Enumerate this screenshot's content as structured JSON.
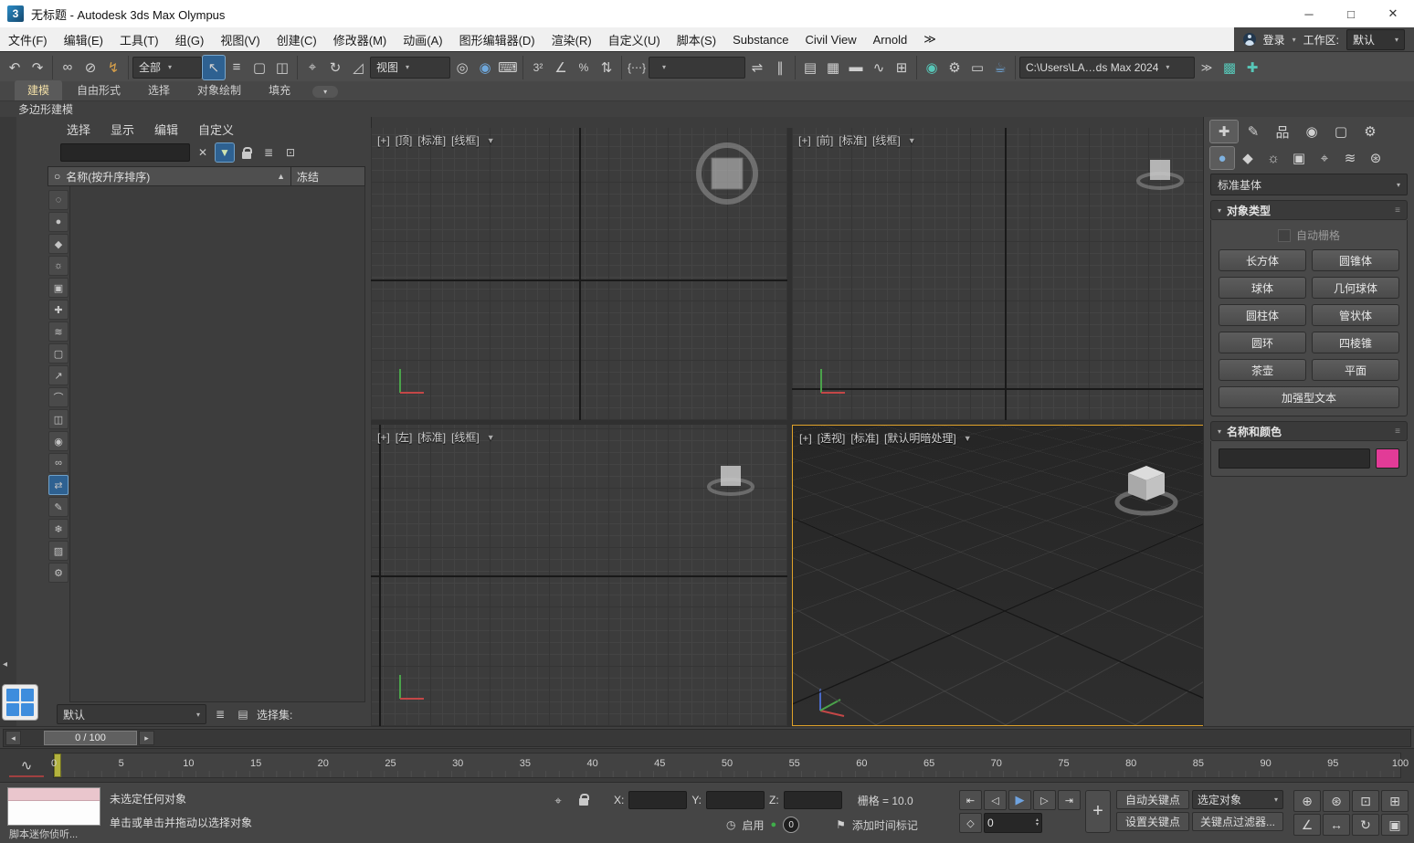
{
  "colors": {
    "active_viewport_border": "#e0a22a",
    "selection_highlight": "#2e6191",
    "name_color_swatch": "#e23b97",
    "play_button": "#6fa3e0",
    "enable_green": "#3fae4a",
    "explorer_layout_blue": "#3e8ddd"
  },
  "ui": {
    "caret": "▾",
    "sort_asc": "▲",
    "grip": "≡",
    "spin_up": "▴",
    "spin_down": "▾"
  },
  "window": {
    "app_badge": "3",
    "title": "无标题 - Autodesk 3ds Max Olympus",
    "min": "─",
    "max": "□",
    "close": "✕"
  },
  "menubar": {
    "items": [
      "文件(F)",
      "编辑(E)",
      "工具(T)",
      "组(G)",
      "视图(V)",
      "创建(C)",
      "修改器(M)",
      "动画(A)",
      "图形编辑器(D)",
      "渲染(R)",
      "自定义(U)",
      "脚本(S)",
      "Substance",
      "Civil View",
      "Arnold"
    ],
    "overflow": "≫",
    "signin": "登录",
    "workspace_label": "工作区:",
    "workspace_value": "默认"
  },
  "toolbar": {
    "filter_value": "全部",
    "coord_value": "视图",
    "path_value": "C:\\Users\\LA…ds Max 2024",
    "overflow": "≫",
    "icons": {
      "undo": "↶",
      "redo": "↷",
      "link": "∞",
      "unlink": "⊘",
      "bind": "↯",
      "select": "↖",
      "select_by_name": "≡",
      "region": "▢",
      "window_crossing": "◫",
      "move": "⌖",
      "rotate": "↻",
      "scale": "◿",
      "pivot": "◎",
      "manipulate": "◉",
      "keyboard": "⌨",
      "snap": "3²",
      "angle_snap": "∠",
      "percent_snap": "%",
      "spinner_snap": "⇅",
      "edit_named": "{⋯}",
      "mirror": "⇌",
      "align": "∥",
      "scene_explorer": "▤",
      "layer_explorer": "▦",
      "ribbon": "▬",
      "curve_editor": "∿",
      "schematic": "⊞",
      "material_editor": "◉",
      "render_setup": "⚙",
      "frame_window": "▭",
      "render": "☕",
      "extra1": "▩",
      "extra2": "✚"
    }
  },
  "ribbon": {
    "tabs": [
      "建模",
      "自由形式",
      "选择",
      "对象绘制",
      "填充"
    ],
    "subtab": "多边形建模"
  },
  "explorer": {
    "menus": [
      "选择",
      "显示",
      "编辑",
      "自定义"
    ],
    "clear": "✕",
    "funnel": "▼",
    "icon_columns": "≣",
    "icon_pick": "⊡",
    "header_radio": "○",
    "columns": {
      "name": "名称(按升序排序)",
      "frozen": "冻结"
    },
    "strip": [
      "◌",
      "●",
      "◆",
      "☼",
      "▣",
      "✚",
      "≋",
      "▢",
      "↗",
      "⌒",
      "◫",
      "◉",
      "∞",
      "⇄",
      "✎",
      "❄",
      "▨",
      "⚙"
    ],
    "footer": {
      "preset": "默认",
      "icon1": "≣",
      "icon2": "▤",
      "selection_set": "选择集:"
    }
  },
  "viewports": {
    "top": {
      "plus": "[+]",
      "view": "[顶]",
      "type": "[标准]",
      "shade": "[线框]"
    },
    "front": {
      "plus": "[+]",
      "view": "[前]",
      "type": "[标准]",
      "shade": "[线框]"
    },
    "left": {
      "plus": "[+]",
      "view": "[左]",
      "type": "[标准]",
      "shade": "[线框]"
    },
    "persp": {
      "plus": "[+]",
      "view": "[透视]",
      "type": "[标准]",
      "shade": "[默认明暗处理]"
    }
  },
  "panel": {
    "tabs1": [
      "✚",
      "✎",
      "品",
      "◉",
      "▢",
      "⚙"
    ],
    "tabs2": [
      "●",
      "◆",
      "☼",
      "▣",
      "⌖",
      "≋",
      "⊛"
    ],
    "category": "标准基体",
    "objects_title": "对象类型",
    "autogrid": "自动栅格",
    "buttons": [
      "长方体",
      "圆锥体",
      "球体",
      "几何球体",
      "圆柱体",
      "管状体",
      "圆环",
      "四棱锥",
      "茶壶",
      "平面",
      "加强型文本"
    ],
    "name_title": "名称和颜色",
    "swatch_style": "background:#e23b97"
  },
  "timeline": {
    "slider": "0 / 100",
    "prev": "◂",
    "next": "▸",
    "curve_icon": "∿",
    "ticks": [
      "0",
      "5",
      "10",
      "15",
      "20",
      "25",
      "30",
      "35",
      "40",
      "45",
      "50",
      "55",
      "60",
      "65",
      "70",
      "75",
      "80",
      "85",
      "90",
      "95",
      "100"
    ]
  },
  "status": {
    "listener_label": "脚本迷你侦听...",
    "line1": "未选定任何对象",
    "line2": "单击或单击并拖动以选择对象",
    "absolute_icon": "⌖",
    "x": "X:",
    "y": "Y:",
    "z": "Z:",
    "grid": "栅格 = 10.0",
    "clock_icon": "◷",
    "enable": "启用",
    "dot": "●",
    "badge": "0",
    "tag_icon": "⚑",
    "time_tag": "添加时间标记",
    "go_start": "⇤",
    "prev_frame": "◁",
    "play": "▶",
    "next_frame": "▷",
    "go_end": "⇥",
    "key_mode": "◇",
    "frame": "0",
    "key_big": "+",
    "auto_key": "自动关键点",
    "set_key": "设置关键点",
    "selected": "选定对象",
    "key_filters": "关键点过滤器...",
    "nav": [
      "⊕",
      "⊛",
      "⊡",
      "⊞",
      "∠",
      "↔",
      "↻",
      "▣"
    ]
  }
}
